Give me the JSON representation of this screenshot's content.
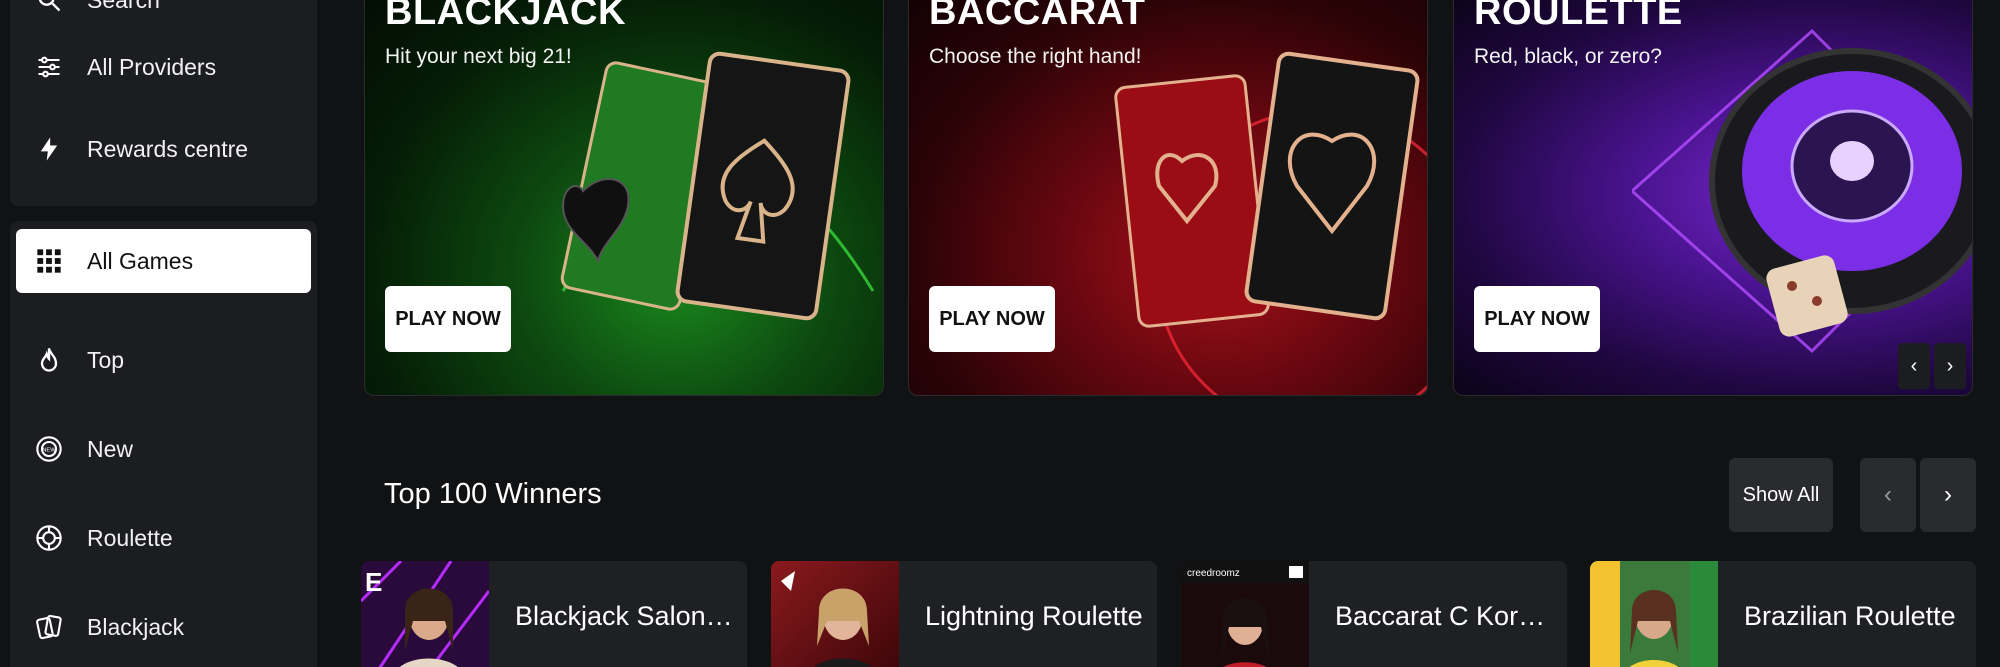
{
  "sidebar": {
    "top_items": [
      {
        "label": "Search",
        "icon": "search-icon"
      },
      {
        "label": "All Providers",
        "icon": "sliders-icon"
      },
      {
        "label": "Rewards centre",
        "icon": "lightning-icon"
      }
    ],
    "game_items": [
      {
        "label": "All Games",
        "icon": "grid-icon",
        "active": true
      },
      {
        "label": "Top",
        "icon": "flame-icon"
      },
      {
        "label": "New",
        "icon": "new-badge-icon"
      },
      {
        "label": "Roulette",
        "icon": "roulette-wheel-icon"
      },
      {
        "label": "Blackjack",
        "icon": "cards-icon"
      }
    ]
  },
  "banners": [
    {
      "title": "BLACKJACK",
      "subtitle": "Hit your next big 21!",
      "button": "PLAY NOW"
    },
    {
      "title": "BACCARAT",
      "subtitle": "Choose the right hand!",
      "button": "PLAY NOW"
    },
    {
      "title": "ROULETTE",
      "subtitle": "Red, black, or zero?",
      "button": "PLAY NOW"
    }
  ],
  "banner_nav": {
    "prev": "‹",
    "next": "›"
  },
  "winners": {
    "title": "Top 100 Winners",
    "show_all": "Show All",
    "prev": "‹",
    "next": "›",
    "games": [
      {
        "name": "Blackjack Salon Pr..."
      },
      {
        "name": "Lightning Roulette"
      },
      {
        "name": "Baccarat C Korean"
      },
      {
        "name": "Brazilian Roulette"
      }
    ],
    "thumb_labels": {
      "provider1": "E",
      "provider3": "creedroomz"
    }
  },
  "colors": {
    "background": "#111214",
    "panel": "#1c1d21",
    "card": "#1f2024",
    "button": "#2a2b2f"
  }
}
